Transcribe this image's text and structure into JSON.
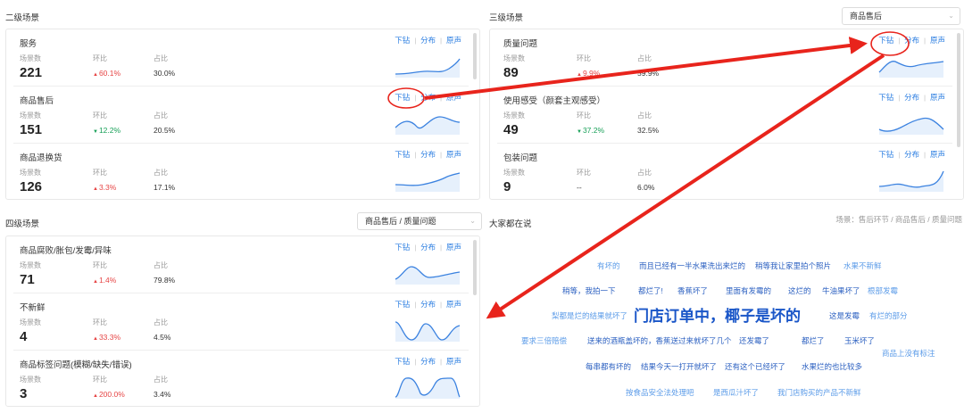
{
  "sections": {
    "level2": {
      "title": "二级场景"
    },
    "level3": {
      "title": "三级场景",
      "filter": "商品售后"
    },
    "level4": {
      "title": "四级场景",
      "filter": "商品售后 / 质量问题"
    },
    "cloud": {
      "title": "大家都在说",
      "path": "场景：售后环节 / 商品售后 / 质量问题"
    }
  },
  "labels": {
    "count": "场景数",
    "ratio_change": "环比",
    "share": "占比"
  },
  "links": {
    "drill": "下钻",
    "distribution": "分布",
    "voice": "原声"
  },
  "level2_items": [
    {
      "name": "服务",
      "count": "221",
      "change": "60.1%",
      "dir": "up",
      "share": "30.0%"
    },
    {
      "name": "商品售后",
      "count": "151",
      "change": "12.2%",
      "dir": "down",
      "share": "20.5%"
    },
    {
      "name": "商品退换货",
      "count": "126",
      "change": "3.3%",
      "dir": "up",
      "share": "17.1%"
    }
  ],
  "level3_items": [
    {
      "name": "质量问题",
      "count": "89",
      "change": "9.9%",
      "dir": "up",
      "share": "59.9%"
    },
    {
      "name": "使用感受（颜套主观感受）",
      "count": "49",
      "change": "37.2%",
      "dir": "down",
      "share": "32.5%"
    },
    {
      "name": "包装问题",
      "count": "9",
      "change": "--",
      "dir": "none",
      "share": "6.0%"
    }
  ],
  "level4_items": [
    {
      "name": "商品腐败/胀包/发霉/异味",
      "count": "71",
      "change": "1.4%",
      "dir": "up",
      "share": "79.8%"
    },
    {
      "name": "不新鲜",
      "count": "4",
      "change": "33.3%",
      "dir": "up",
      "share": "4.5%"
    },
    {
      "name": "商品标签问题(模糊/缺失/错误)",
      "count": "3",
      "change": "200.0%",
      "dir": "up",
      "share": "3.4%"
    }
  ],
  "cloud_words": [
    "有坏的",
    "而且已经有一半水果洗出来烂的",
    "稍等我让家里拍个照片",
    "水果不新鲜",
    "稍等，我拍一下",
    "都烂了!",
    "香蕉坏了",
    "里面有发霉的",
    "这烂的",
    "牛油果坏了",
    "根部发霉",
    "梨都是烂的结果就坏了",
    "门店订单中，椰子是坏的",
    "这是发霉",
    "有烂的部分",
    "要求三倍赔偿",
    "送来的酒瓶盖坏的，香蕉送过来就坏了几个",
    "还发霉了",
    "都烂了",
    "玉米坏了",
    "商品上没有标注",
    "每串都有坏的",
    "结果今天一打开就坏了",
    "还有这个已经坏了",
    "水果烂的也比较多",
    "按食品安全法处理吧",
    "是西瓜汁坏了",
    "我门店购买的产品不新鲜"
  ],
  "colors": {
    "link": "#2a7de1",
    "up": "#e64545",
    "down": "#18a058",
    "annotation": "#e8241c"
  }
}
